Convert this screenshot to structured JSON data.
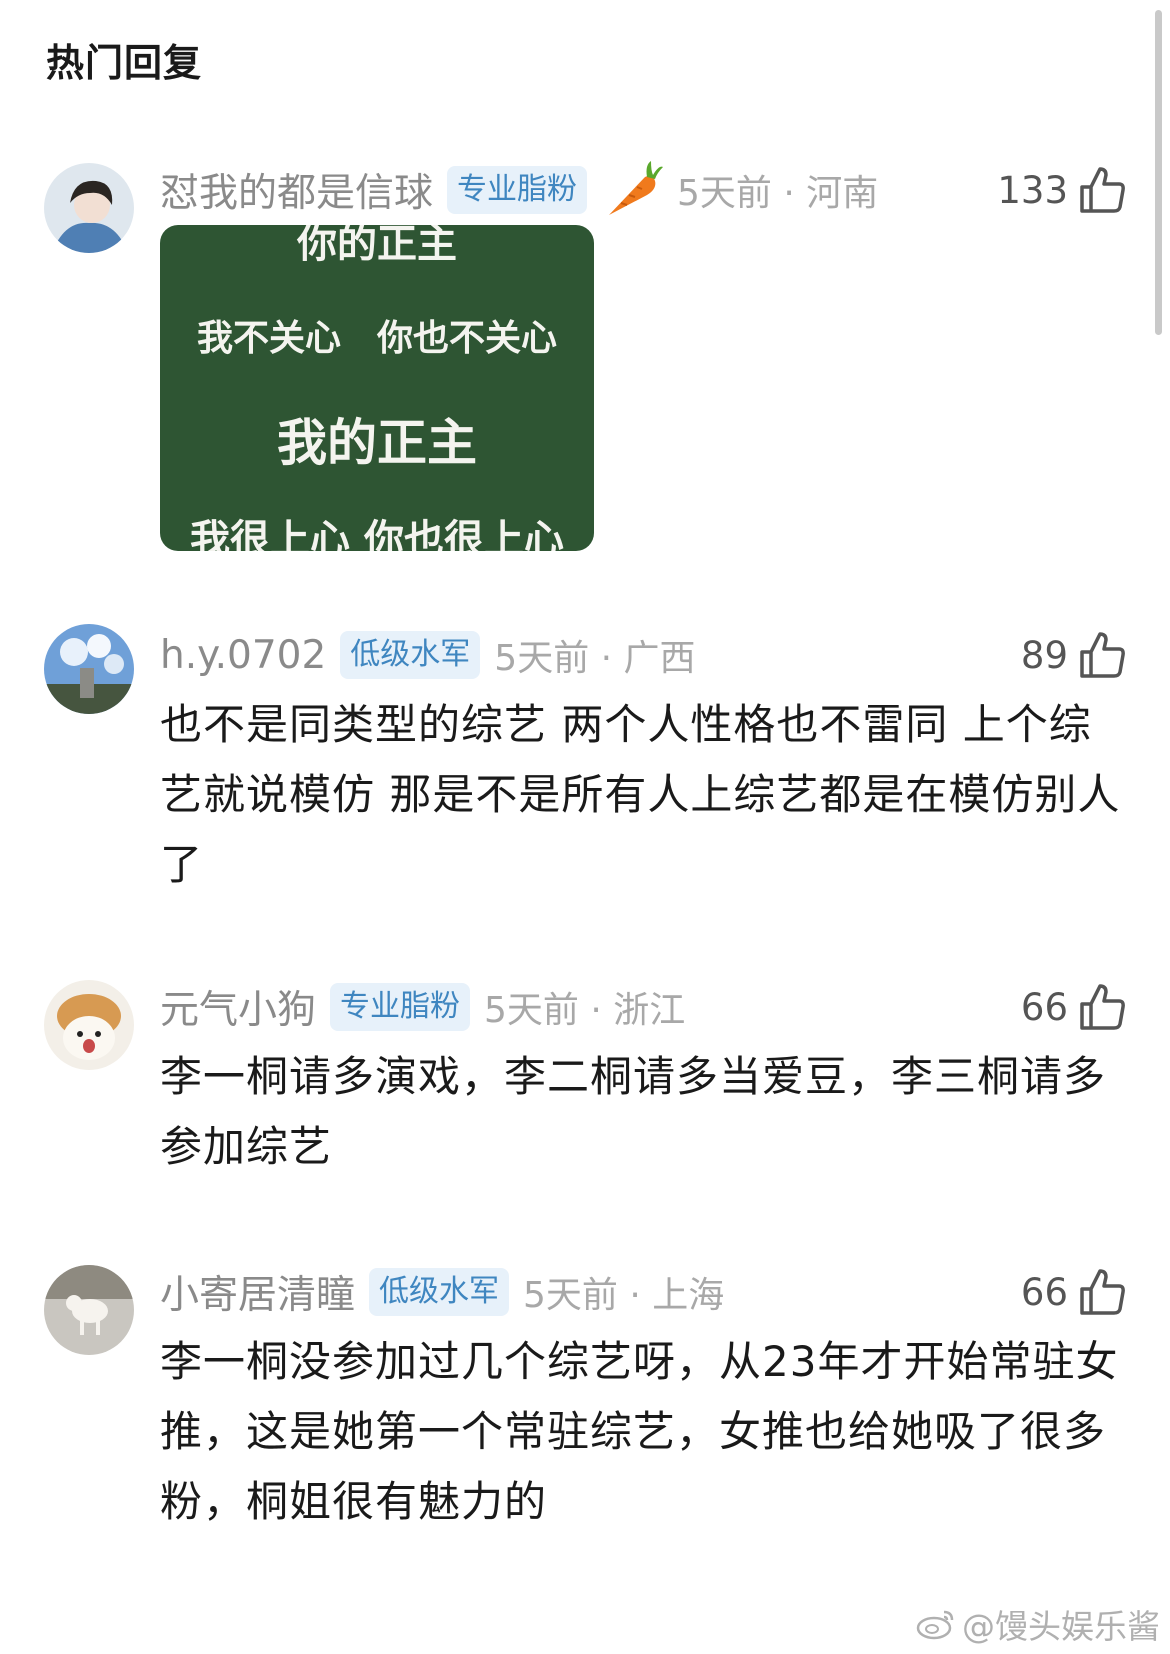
{
  "section_title": "热门回复",
  "comments": [
    {
      "username": "怼我的都是信球",
      "badge": "专业脂粉",
      "time_location": "5天前 · 河南",
      "likes": "133",
      "board_lines": [
        "你的正主",
        "我不关心　你也不关心",
        "我的正主",
        "我很上心 你也很上心"
      ]
    },
    {
      "username": "h.y.0702",
      "badge": "低级水军",
      "time_location": "5天前 · 广西",
      "likes": "89",
      "text": "也不是同类型的综艺 两个人性格也不雷同 上个综艺就说模仿 那是不是所有人上综艺都是在模仿别人了"
    },
    {
      "username": "元气小狗",
      "badge": "专业脂粉",
      "time_location": "5天前 · 浙江",
      "likes": "66",
      "text": "李一桐请多演戏，李二桐请多当爱豆，李三桐请多参加综艺"
    },
    {
      "username": "小寄居清瞳",
      "badge": "低级水军",
      "time_location": "5天前 · 上海",
      "likes": "66",
      "text": "李一桐没参加过几个综艺呀，从23年才开始常驻女推，这是她第一个常驻综艺，女推也给她吸了很多粉，桐姐很有魅力的"
    }
  ],
  "watermark": "@馒头娱乐酱",
  "colors": {
    "badge_text": "#3f86c0",
    "badge_bg": "#e7f1fa",
    "board": "#2e5533"
  }
}
